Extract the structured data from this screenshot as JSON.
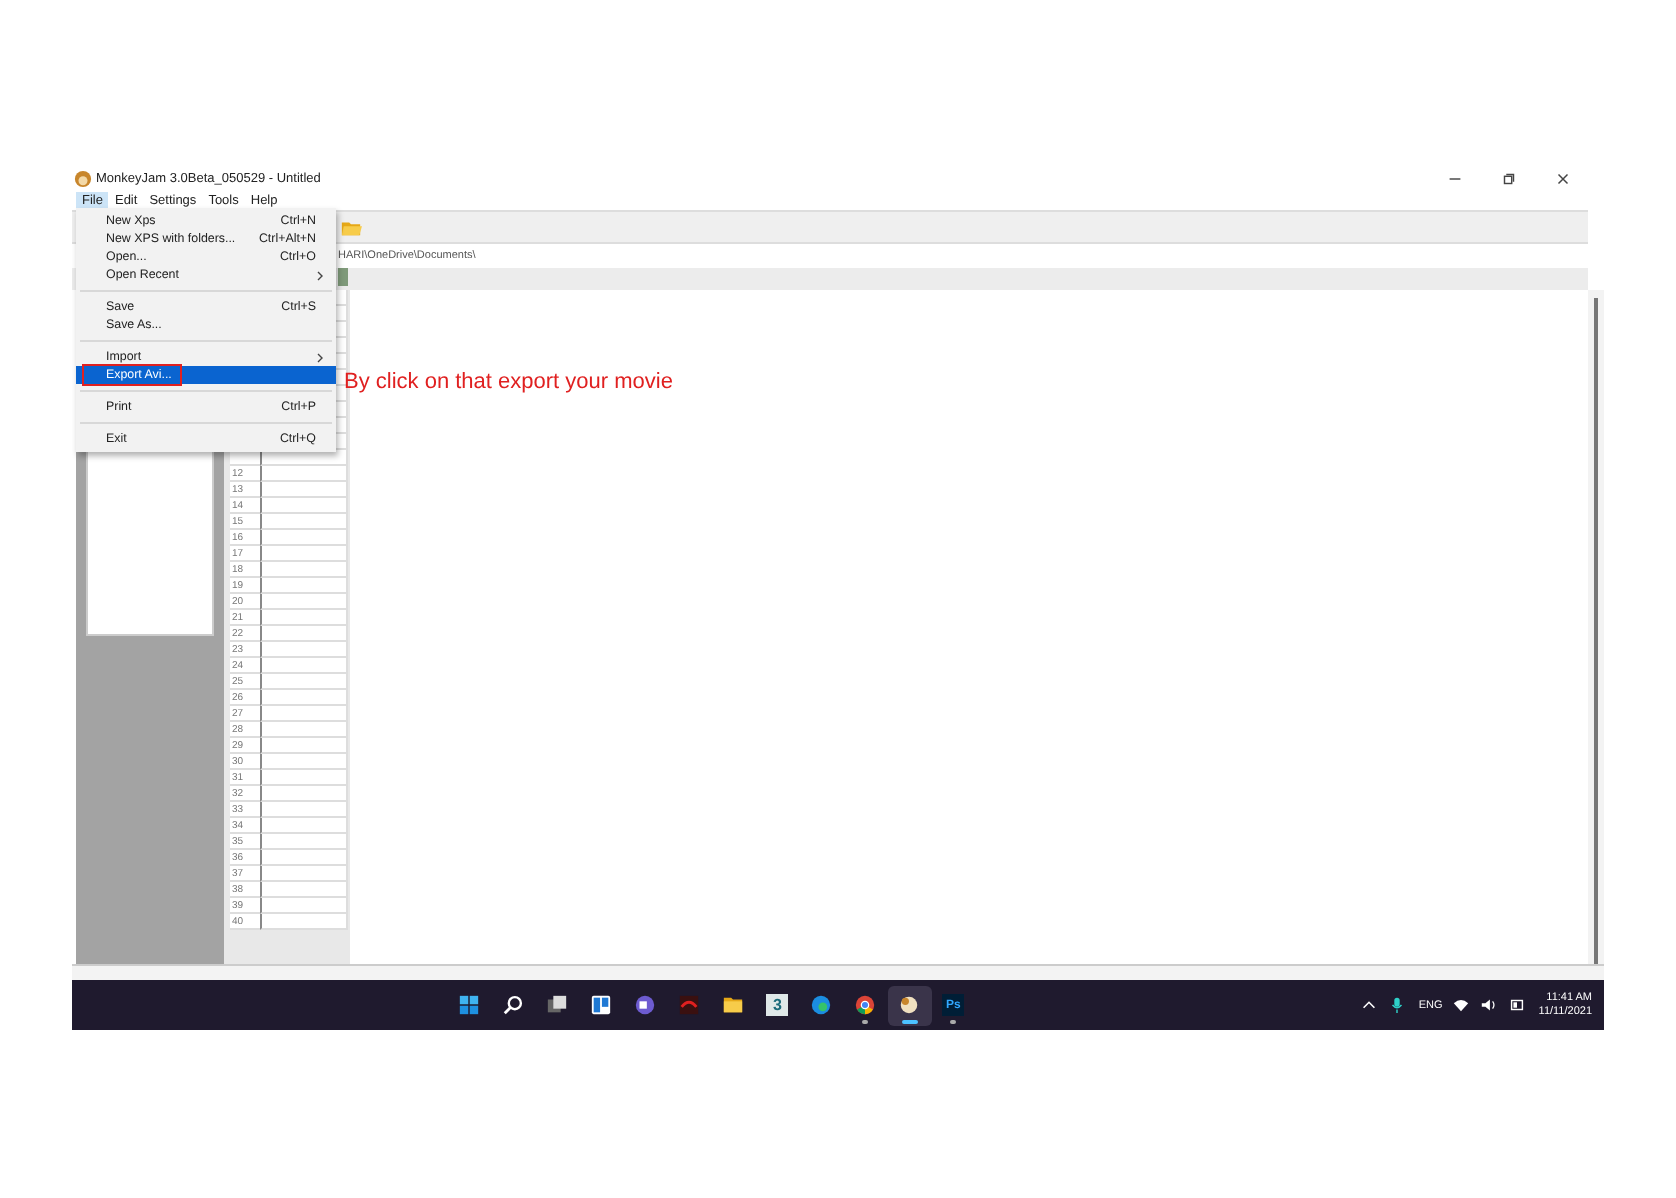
{
  "window": {
    "title": "MonkeyJam 3.0Beta_050529 - Untitled"
  },
  "menu_bar": [
    {
      "label": "File",
      "selected": true
    },
    {
      "label": "Edit",
      "selected": false
    },
    {
      "label": "Settings",
      "selected": false
    },
    {
      "label": "Tools",
      "selected": false
    },
    {
      "label": "Help",
      "selected": false
    }
  ],
  "file_menu": [
    {
      "kind": "item",
      "label": "New Xps",
      "shortcut": "Ctrl+N",
      "submenu": false,
      "selected": false
    },
    {
      "kind": "item",
      "label": "New XPS with folders...",
      "shortcut": "Ctrl+Alt+N",
      "submenu": false,
      "selected": false
    },
    {
      "kind": "item",
      "label": "Open...",
      "shortcut": "Ctrl+O",
      "submenu": false,
      "selected": false
    },
    {
      "kind": "item",
      "label": "Open Recent",
      "submenu": true,
      "selected": false
    },
    {
      "kind": "separator"
    },
    {
      "kind": "item",
      "label": "Save",
      "shortcut": "Ctrl+S",
      "submenu": false,
      "selected": false
    },
    {
      "kind": "item",
      "label": "Save As...",
      "submenu": false,
      "selected": false
    },
    {
      "kind": "separator"
    },
    {
      "kind": "item",
      "label": "Import",
      "submenu": true,
      "selected": false
    },
    {
      "kind": "item",
      "label": "Export Avi...",
      "submenu": false,
      "selected": true
    },
    {
      "kind": "separator"
    },
    {
      "kind": "item",
      "label": "Print",
      "shortcut": "Ctrl+P",
      "submenu": false,
      "selected": false
    },
    {
      "kind": "separator"
    },
    {
      "kind": "item",
      "label": "Exit",
      "shortcut": "Ctrl+Q",
      "submenu": false,
      "selected": false
    }
  ],
  "path": "HARI\\OneDrive\\Documents\\",
  "frame_rows": [
    "12",
    "13",
    "14",
    "15",
    "16",
    "17",
    "18",
    "19",
    "20",
    "21",
    "22",
    "23",
    "24",
    "25",
    "26",
    "27",
    "28",
    "29",
    "30",
    "31",
    "32",
    "33",
    "34",
    "35",
    "36",
    "37",
    "38",
    "39",
    "40"
  ],
  "annotation": "By click on that export your movie",
  "taskbar": {
    "apps": [
      {
        "kind": "start",
        "running": false,
        "active": false
      },
      {
        "kind": "search",
        "running": false,
        "active": false
      },
      {
        "kind": "taskview",
        "running": false,
        "active": false
      },
      {
        "kind": "widgets",
        "running": false,
        "active": false
      },
      {
        "kind": "chat",
        "running": false,
        "active": false
      },
      {
        "kind": "game",
        "running": false,
        "active": false
      },
      {
        "kind": "folder",
        "running": false,
        "active": false
      },
      {
        "kind": "app3",
        "label": "3",
        "running": false,
        "active": false
      },
      {
        "kind": "edge",
        "running": false,
        "active": false
      },
      {
        "kind": "chrome",
        "running": true,
        "active": false
      },
      {
        "kind": "monkey",
        "running": true,
        "active": true
      },
      {
        "kind": "ps",
        "label": "Ps",
        "running": true,
        "active": false
      }
    ],
    "language": "ENG",
    "time": "11:41 AM",
    "date": "11/11/2021"
  }
}
